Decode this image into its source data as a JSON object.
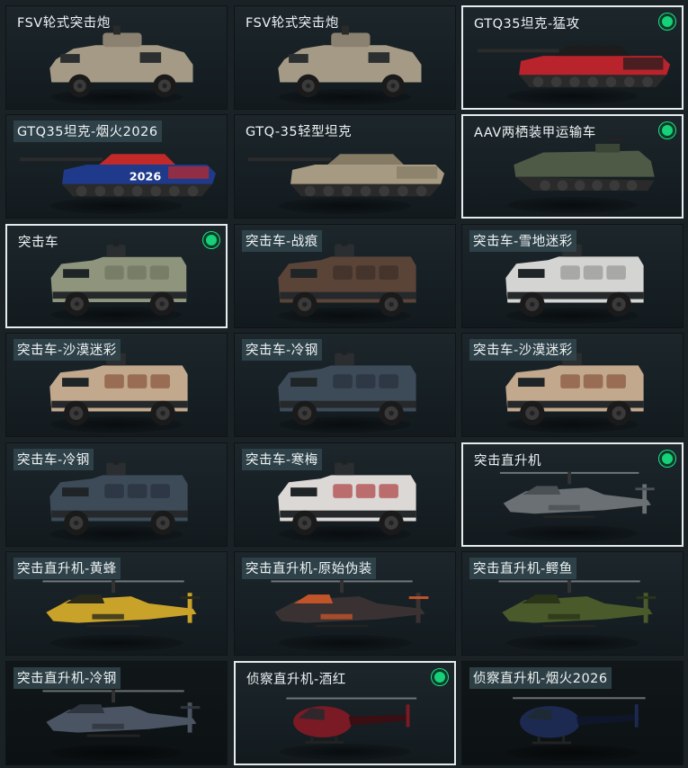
{
  "cards": [
    {
      "name": "FSV轮式突击炮",
      "selected": false,
      "active": false,
      "kind": "fsv",
      "body": "#a59a86",
      "accent": "#8a8170",
      "label_box": false
    },
    {
      "name": "FSV轮式突击炮",
      "selected": false,
      "active": false,
      "kind": "fsv",
      "body": "#a59a86",
      "accent": "#8a8170",
      "label_box": false
    },
    {
      "name": "GTQ35坦克-猛攻",
      "selected": true,
      "active": true,
      "kind": "tank",
      "body": "#b8232c",
      "accent": "#1c1c1c",
      "label_box": false
    },
    {
      "name": "GTQ35坦克-烟火2026",
      "selected": false,
      "active": false,
      "kind": "tank",
      "body": "#1f3a8a",
      "accent": "#c22a2a",
      "label_box": true,
      "tag": "2026"
    },
    {
      "name": "GTQ-35轻型坦克",
      "selected": false,
      "active": false,
      "kind": "tank",
      "body": "#a69a82",
      "accent": "#857a64",
      "label_box": false
    },
    {
      "name": "AAV两栖装甲运输车",
      "selected": true,
      "active": true,
      "kind": "aav",
      "body": "#4e5a45",
      "accent": "#3c4636",
      "label_box": false
    },
    {
      "name": "突击车",
      "selected": true,
      "active": true,
      "kind": "mrap",
      "body": "#8f957c",
      "accent": "#6f7560",
      "label_box": false
    },
    {
      "name": "突击车-战痕",
      "selected": false,
      "active": false,
      "kind": "mrap",
      "body": "#5a4438",
      "accent": "#3f2f27",
      "label_box": true
    },
    {
      "name": "突击车-雪地迷彩",
      "selected": false,
      "active": false,
      "kind": "mrap",
      "body": "#d4d4d2",
      "accent": "#9a9a98",
      "label_box": true
    },
    {
      "name": "突击车-沙漠迷彩",
      "selected": false,
      "active": false,
      "kind": "mrap",
      "body": "#c2a88c",
      "accent": "#8a5a40",
      "label_box": true
    },
    {
      "name": "突击车-冷钢",
      "selected": false,
      "active": false,
      "kind": "mrap",
      "body": "#3d4a58",
      "accent": "#2a333d",
      "label_box": true
    },
    {
      "name": "突击车-沙漠迷彩",
      "selected": false,
      "active": false,
      "kind": "mrap",
      "body": "#c2a88c",
      "accent": "#8a5a40",
      "label_box": true
    },
    {
      "name": "突击车-冷钢",
      "selected": false,
      "active": false,
      "kind": "mrap",
      "body": "#3d4a58",
      "accent": "#2a333d",
      "label_box": true
    },
    {
      "name": "突击车-寒梅",
      "selected": false,
      "active": false,
      "kind": "mrap",
      "body": "#dcd8d6",
      "accent": "#b04a4a",
      "label_box": true
    },
    {
      "name": "突击直升机",
      "selected": true,
      "active": true,
      "kind": "heli",
      "body": "#6a7073",
      "accent": "#4a5053",
      "label_box": false
    },
    {
      "name": "突击直升机-黄蜂",
      "selected": false,
      "active": false,
      "kind": "heli",
      "body": "#c9a22a",
      "accent": "#2a2a1a",
      "label_box": true
    },
    {
      "name": "突击直升机-原始伪装",
      "selected": false,
      "active": false,
      "kind": "heli",
      "body": "#3a3232",
      "accent": "#c2542a",
      "label_box": true
    },
    {
      "name": "突击直升机-鳄鱼",
      "selected": false,
      "active": false,
      "kind": "heli",
      "body": "#4a5a2a",
      "accent": "#2a3418",
      "label_box": true
    },
    {
      "name": "突击直升机-冷钢",
      "selected": false,
      "active": false,
      "kind": "heli",
      "body": "#4a5462",
      "accent": "#2e353f",
      "label_box": true
    },
    {
      "name": "侦察直升机-酒红",
      "selected": true,
      "active": true,
      "kind": "scout",
      "body": "#7a1a24",
      "accent": "#3a0e12",
      "label_box": false
    },
    {
      "name": "侦察直升机-烟火2026",
      "selected": false,
      "active": false,
      "kind": "scout",
      "body": "#1c2a52",
      "accent": "#0f162a",
      "label_box": true
    }
  ]
}
